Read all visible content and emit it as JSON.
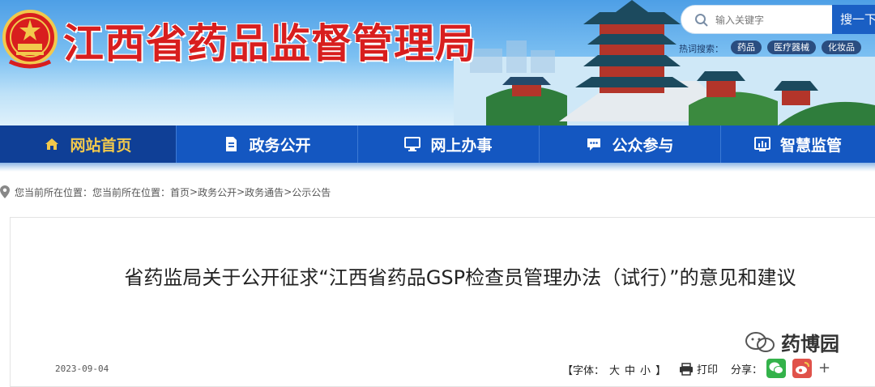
{
  "header": {
    "site_title": "江西省药品监督管理局",
    "search": {
      "placeholder": "输入关键字",
      "button_label": "搜一下"
    },
    "hot_label": "热词搜索：",
    "hot_tags": [
      "药品",
      "医疗器械",
      "化妆品"
    ]
  },
  "nav": {
    "items": [
      {
        "label": "网站首页",
        "icon": "home-icon",
        "active": true
      },
      {
        "label": "政务公开",
        "icon": "document-icon",
        "active": false
      },
      {
        "label": "网上办事",
        "icon": "monitor-icon",
        "active": false
      },
      {
        "label": "公众参与",
        "icon": "chat-icon",
        "active": false
      },
      {
        "label": "智慧监管",
        "icon": "chart-icon",
        "active": false
      }
    ]
  },
  "breadcrumb": {
    "prefix": "您当前所在位置：您当前所在位置：",
    "items": [
      "首页",
      "政务公开",
      "政务通告",
      "公示公告"
    ],
    "separator": ">"
  },
  "article": {
    "title": "省药监局关于公开征求“江西省药品GSP检查员管理办法（试行）”的意见和建议",
    "date": "2023-09-04",
    "font_label": "【字体：",
    "font_sizes": [
      "大",
      "中",
      "小"
    ],
    "font_close": "】",
    "print_label": "打印",
    "share_label": "分享：",
    "share_more": "+"
  },
  "watermark": "药博园",
  "colors": {
    "nav_bg": "#1457c1",
    "nav_active_bg": "#0f3f96",
    "nav_active_text": "#f2c94c",
    "title_red": "#d81e1e",
    "search_button": "#1a5fc4"
  }
}
